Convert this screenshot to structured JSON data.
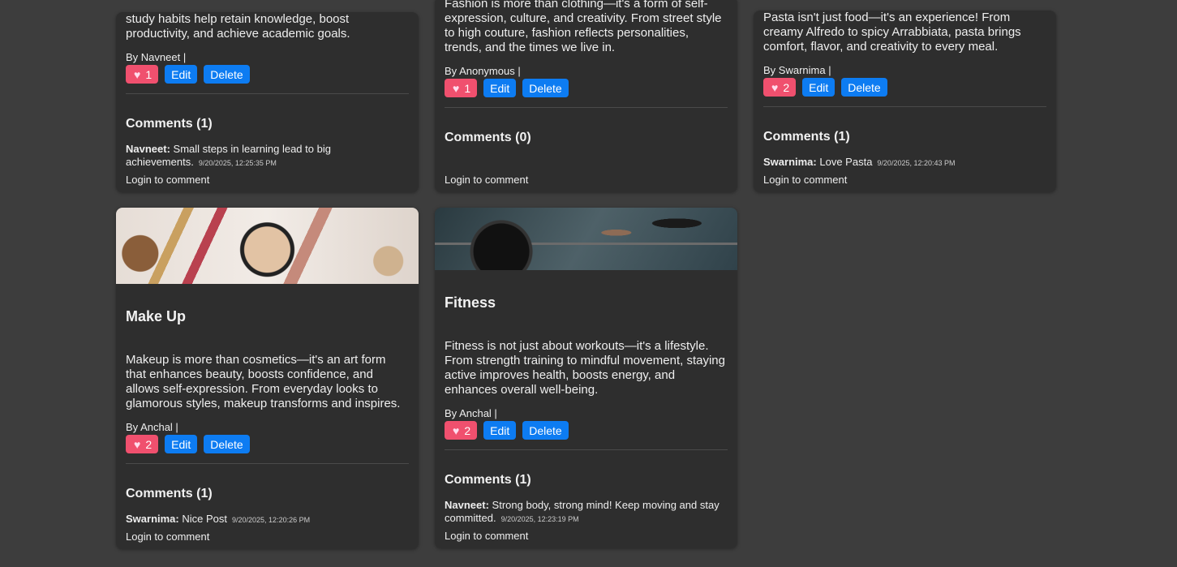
{
  "posts_top": [
    {
      "description": "study habits help retain knowledge, boost productivity, and achieve academic goals.",
      "author": "By Navneet |",
      "likes": "1",
      "edit_label": "Edit",
      "delete_label": "Delete",
      "comments_header": "Comments (1)",
      "comments": [
        {
          "user": "Navneet:",
          "text": "Small steps in learning lead to big achievements.",
          "time": "9/20/2025, 12:25:35 PM"
        }
      ],
      "login_label": "Login to comment"
    },
    {
      "description": "Fashion is more than clothing—it's a form of self-expression, culture, and creativity. From street style to high couture, fashion reflects personalities, trends, and the times we live in.",
      "author": "By Anonymous |",
      "likes": "1",
      "edit_label": "Edit",
      "delete_label": "Delete",
      "comments_header": "Comments (0)",
      "comments": [],
      "login_label": "Login to comment"
    },
    {
      "description": "Pasta isn't just food—it's an experience! From creamy Alfredo to spicy Arrabbiata, pasta brings comfort, flavor, and creativity to every meal.",
      "author": "By Swarnima |",
      "likes": "2",
      "edit_label": "Edit",
      "delete_label": "Delete",
      "comments_header": "Comments (1)",
      "comments": [
        {
          "user": "Swarnima:",
          "text": "Love Pasta",
          "time": "9/20/2025, 12:20:43 PM"
        }
      ],
      "login_label": "Login to comment"
    }
  ],
  "posts_bottom": [
    {
      "image": "makeup",
      "title": "Make Up",
      "description": "Makeup is more than cosmetics—it's an art form that enhances beauty, boosts confidence, and allows self-expression. From everyday looks to glamorous styles, makeup transforms and inspires.",
      "author": "By Anchal |",
      "likes": "2",
      "edit_label": "Edit",
      "delete_label": "Delete",
      "comments_header": "Comments (1)",
      "comments": [
        {
          "user": "Swarnima:",
          "text": "Nice Post",
          "time": "9/20/2025, 12:20:26 PM"
        }
      ],
      "login_label": "Login to comment"
    },
    {
      "image": "fitness",
      "title": "Fitness",
      "description": "Fitness is not just about workouts—it's a lifestyle. From strength training to mindful movement, staying active improves health, boosts energy, and enhances overall well-being.",
      "author": "By Anchal |",
      "likes": "2",
      "edit_label": "Edit",
      "delete_label": "Delete",
      "comments_header": "Comments (1)",
      "comments": [
        {
          "user": "Navneet:",
          "text": "Strong body, strong mind! Keep moving and stay committed.",
          "time": "9/20/2025, 12:23:19 PM"
        }
      ],
      "login_label": "Login to comment"
    }
  ],
  "colors": {
    "like": "#f0506e",
    "button": "#0d7cf2",
    "card": "#2e2e2e",
    "background": "#3d3d3d"
  },
  "icons": {
    "like": "heart-icon"
  }
}
